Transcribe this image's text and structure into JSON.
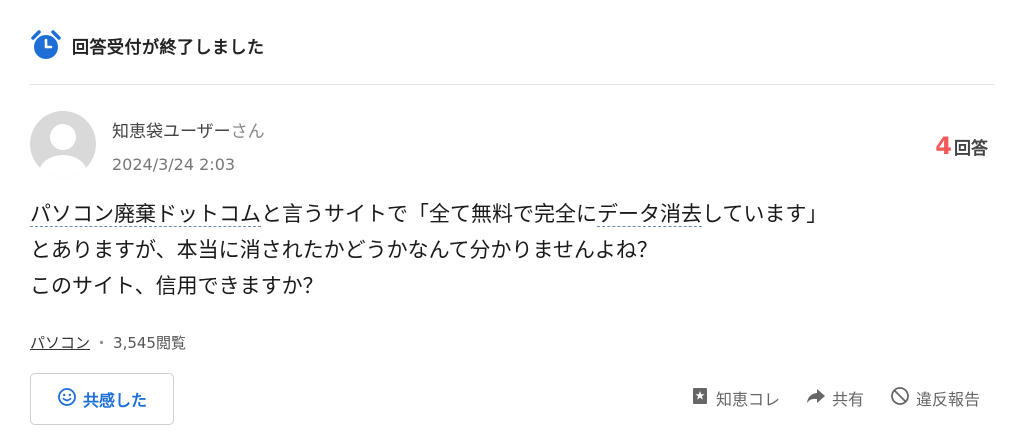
{
  "status": {
    "text": "回答受付が終了しました"
  },
  "user": {
    "name": "知恵袋ユーザー",
    "honorific": "さん",
    "date": "2024/3/24 2:03"
  },
  "answers": {
    "count": "4",
    "unit": "回答"
  },
  "question": {
    "line1_pre": "",
    "keyword1": "パソコン廃棄ドットコム",
    "line1_mid": "と言うサイトで「全て無料で完全に",
    "keyword2": "データ消去",
    "line1_post": "しています」",
    "line2": "とありますが、本当に消されたかどうかなんて分かりませんよね？",
    "line3": "このサイト、信用できますか？"
  },
  "meta": {
    "category": "パソコン",
    "separator": "・",
    "views": "3,545閲覧"
  },
  "buttons": {
    "empathy": "共感した",
    "chiekore": "知恵コレ",
    "share": "共有",
    "report": "違反報告"
  },
  "colors": {
    "accent_blue": "#1d6fd6",
    "answer_red": "#f25a5a"
  },
  "icons": [
    "alarm-clock-icon",
    "smile-icon",
    "bookmark-icon",
    "share-arrow-icon",
    "prohibit-icon"
  ]
}
